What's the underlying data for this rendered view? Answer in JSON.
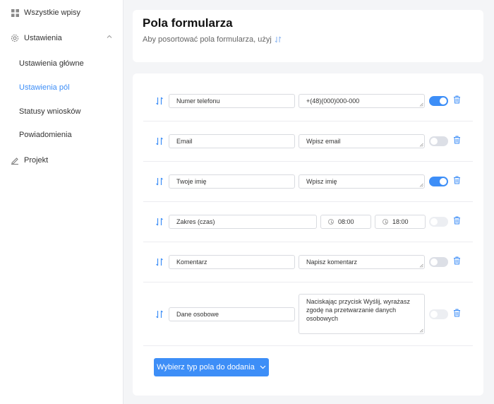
{
  "sidebar": {
    "all_entries": "Wszystkie wpisy",
    "settings": "Ustawienia",
    "sub": [
      "Ustawienia główne",
      "Ustawienia pól",
      "Statusy wniosków",
      "Powiadomienia"
    ],
    "project": "Projekt"
  },
  "header": {
    "title": "Pola formularza",
    "subtitle": "Aby posortować pola formularza, użyj"
  },
  "fields": [
    {
      "label": "Numer telefonu",
      "placeholder": "+(48)(000)000-000",
      "enabled": true
    },
    {
      "label": "Email",
      "placeholder": "Wpisz email",
      "enabled": false
    },
    {
      "label": "Twoje imię",
      "placeholder": "Wpisz imię",
      "enabled": true
    },
    {
      "label": "Zakres (czas)",
      "time_from": "08:00",
      "time_to": "18:00",
      "enabled": false
    },
    {
      "label": "Komentarz",
      "placeholder": "Napisz komentarz",
      "enabled": false
    },
    {
      "label": "Dane osobowe",
      "placeholder": "Naciskając przycisk Wyślij, wyrażasz zgodę na przetwarzanie danych osobowych",
      "enabled": false
    }
  ],
  "add_button": "Wybierz typ pola do dodania",
  "colors": {
    "accent": "#3d8ef7",
    "toggle_off": "#dcdfe6"
  }
}
